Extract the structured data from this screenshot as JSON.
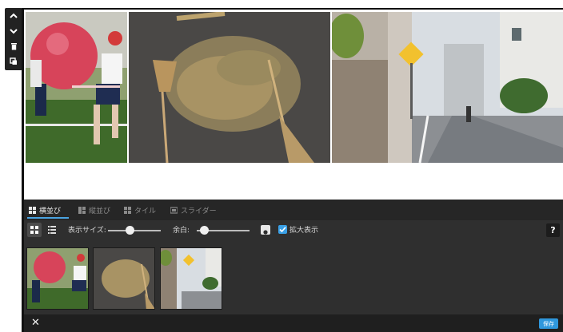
{
  "toolbar": {
    "items": [
      {
        "icon": "chevron-up-icon"
      },
      {
        "icon": "chevron-down-icon"
      },
      {
        "icon": "trash-icon"
      },
      {
        "icon": "copy-icon"
      }
    ]
  },
  "preview": {
    "images": [
      {
        "scene": "children-with-red-ball"
      },
      {
        "scene": "fallen-leaves-with-brooms"
      },
      {
        "scene": "residential-street"
      }
    ]
  },
  "editor": {
    "tabs": [
      {
        "label": "横並び",
        "icon": "grid-horizontal-icon",
        "active": true
      },
      {
        "label": "縦並び",
        "icon": "grid-vertical-icon",
        "active": false
      },
      {
        "label": "タイル",
        "icon": "tile-icon",
        "active": false
      },
      {
        "label": "スライダー",
        "icon": "slider-icon",
        "active": false
      }
    ],
    "controls": {
      "display_size_label": "表示サイズ:",
      "display_size_value": 0.42,
      "margin_label": "余白:",
      "margin_value": 0.15,
      "zoom_label": "拡大表示",
      "zoom_checked": true,
      "help_label": "?"
    },
    "thumbnails": [
      {
        "scene": "children-with-red-ball"
      },
      {
        "scene": "fallen-leaves-with-brooms"
      },
      {
        "scene": "residential-street"
      }
    ],
    "footer": {
      "close_label": "✕",
      "save_label": "保存"
    }
  },
  "colors": {
    "accent": "#3aa0e6",
    "panel": "#2f2f2f",
    "toolbar": "#222222"
  }
}
